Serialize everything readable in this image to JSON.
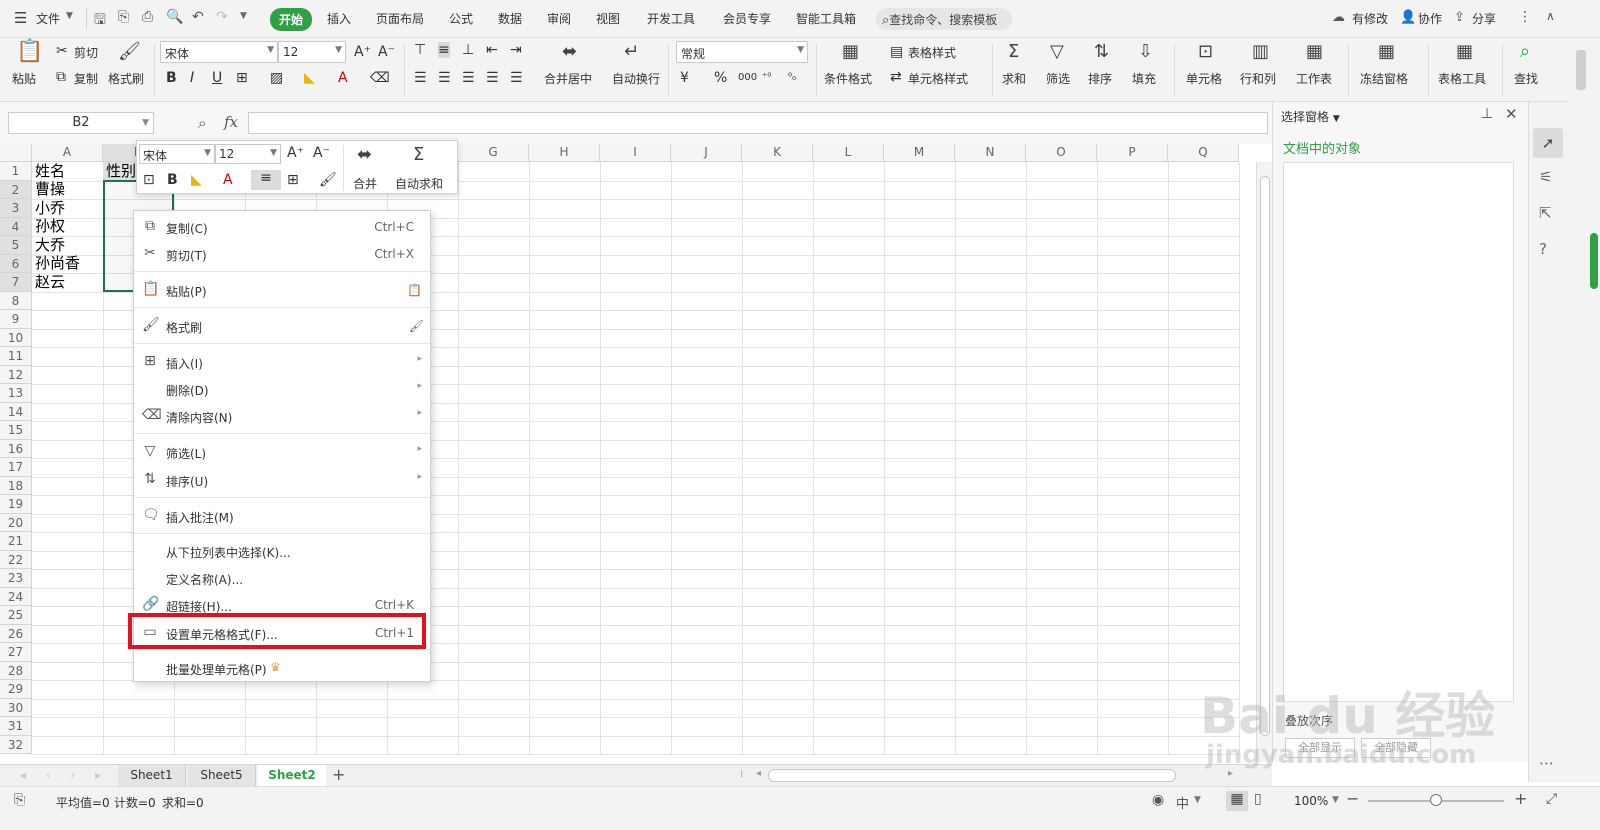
{
  "menubar": {
    "file_label": "文件",
    "tabs": [
      "开始",
      "插入",
      "页面布局",
      "公式",
      "数据",
      "审阅",
      "视图",
      "开发工具",
      "会员专享",
      "智能工具箱"
    ],
    "search_placeholder": "查找命令、搜索模板",
    "right": {
      "modified": "有修改",
      "collab": "协作",
      "share": "分享"
    }
  },
  "ribbon": {
    "paste": "粘贴",
    "cut": "剪切",
    "copy": "复制",
    "format_painter": "格式刷",
    "font_name": "宋体",
    "font_size": "12",
    "merge_center": "合并居中",
    "auto_wrap": "自动换行",
    "number_format": "常规",
    "cond_format": "条件格式",
    "table_style": "表格样式",
    "cell_style": "单元格样式",
    "sum": "求和",
    "filter": "筛选",
    "sort": "排序",
    "fill": "填充",
    "cell": "单元格",
    "row_col": "行和列",
    "worksheet": "工作表",
    "freeze": "冻结窗格",
    "table_tools": "表格工具",
    "find": "查找"
  },
  "formula": {
    "name_box": "B2",
    "fx": "fx"
  },
  "columns": [
    "A",
    "B",
    "C",
    "D",
    "E",
    "F",
    "G",
    "H",
    "I",
    "J",
    "K",
    "L",
    "M",
    "N",
    "O",
    "P",
    "Q"
  ],
  "rows": [
    "1",
    "2",
    "3",
    "4",
    "5",
    "6",
    "7",
    "8",
    "9",
    "10",
    "11",
    "12",
    "13",
    "14",
    "15",
    "16",
    "17",
    "18",
    "19",
    "20",
    "21",
    "22",
    "23",
    "24",
    "25",
    "26",
    "27",
    "28",
    "29",
    "30",
    "31",
    "32"
  ],
  "cells": {
    "a1": "姓名",
    "b1": "性别",
    "a2": "曹操",
    "a3": "小乔",
    "a4": "孙权",
    "a5": "大乔",
    "a6": "孙尚香",
    "a7": "赵云"
  },
  "mini_toolbar": {
    "font": "宋体",
    "size": "12",
    "merge": "合并",
    "autosum": "自动求和"
  },
  "context_menu": {
    "copy": "复制(C)",
    "copy_sc": "Ctrl+C",
    "cut": "剪切(T)",
    "cut_sc": "Ctrl+X",
    "paste": "粘贴(P)",
    "format_painter": "格式刷",
    "insert": "插入(I)",
    "delete": "删除(D)",
    "clear": "清除内容(N)",
    "filter": "筛选(L)",
    "sort": "排序(U)",
    "insert_comment": "插入批注(M)",
    "pick_list": "从下拉列表中选择(K)...",
    "define_name": "定义名称(A)...",
    "hyperlink": "超链接(H)...",
    "hyperlink_sc": "Ctrl+K",
    "format_cells": "设置单元格格式(F)...",
    "format_cells_sc": "Ctrl+1",
    "batch": "批量处理单元格(P)"
  },
  "right_panel": {
    "title": "选择窗格",
    "subtitle": "文档中的对象",
    "partial_label": "叠放次序",
    "show_all": "全部显示",
    "hide_all": "全部隐藏"
  },
  "sheets": [
    "Sheet1",
    "Sheet5",
    "Sheet2"
  ],
  "active_sheet": "Sheet2",
  "status": {
    "avg": "平均值=0",
    "count": "计数=0",
    "sum": "求和=0",
    "zoom": "100%",
    "lang": "中"
  },
  "watermark": {
    "logo": "Bai du 经验",
    "url": "jingyan.baidu.com"
  },
  "colors": {
    "accent": "#2fa046",
    "highlight": "#e3101e",
    "selection": "#217346"
  }
}
